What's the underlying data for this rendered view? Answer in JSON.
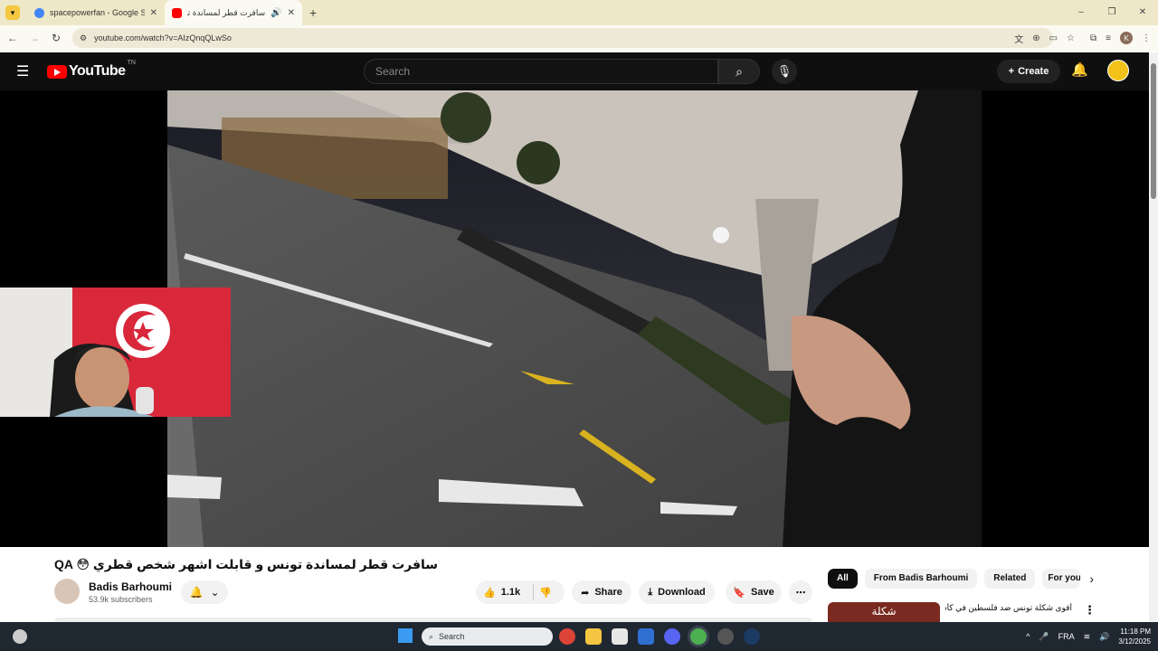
{
  "browser": {
    "tabs": [
      {
        "title": "spacepowerfan - Google Search",
        "active": false
      },
      {
        "title": "سافرت قطر لمساندة تونس و",
        "active": true
      }
    ],
    "url": "youtube.com/watch?v=AIzQnqQLwSo",
    "window_controls": [
      "–",
      "❐",
      "✕"
    ]
  },
  "youtube": {
    "logo_text": "YouTube",
    "logo_country": "TN",
    "search_placeholder": "Search",
    "create_label": "Create"
  },
  "video": {
    "title": "QA 😳 سافرت قطر لمساندة تونس و قابلت اشهر شخص قطري",
    "channel_name": "Badis Barhoumi",
    "subscribers": "53.9k subscribers",
    "likes": "1.1k",
    "share_label": "Share",
    "download_label": "Download",
    "save_label": "Save"
  },
  "sidebar": {
    "chips": [
      "All",
      "From Badis Barhoumi",
      "Related",
      "For you"
    ],
    "first_rec_thumb_text": "شكلة",
    "first_rec_title": "أقوى شكلة تونس ضد فلسطين في كأس العرب"
  },
  "taskbar": {
    "search_placeholder": "Search",
    "language": "FRA",
    "time": "11:18 PM",
    "date": "3/12/2025"
  },
  "colors": {
    "youtube_red": "#ff0000",
    "header_bg": "#0f0f0f",
    "browser_frame": "#eee8c8",
    "taskbar_bg": "#1f2731"
  }
}
